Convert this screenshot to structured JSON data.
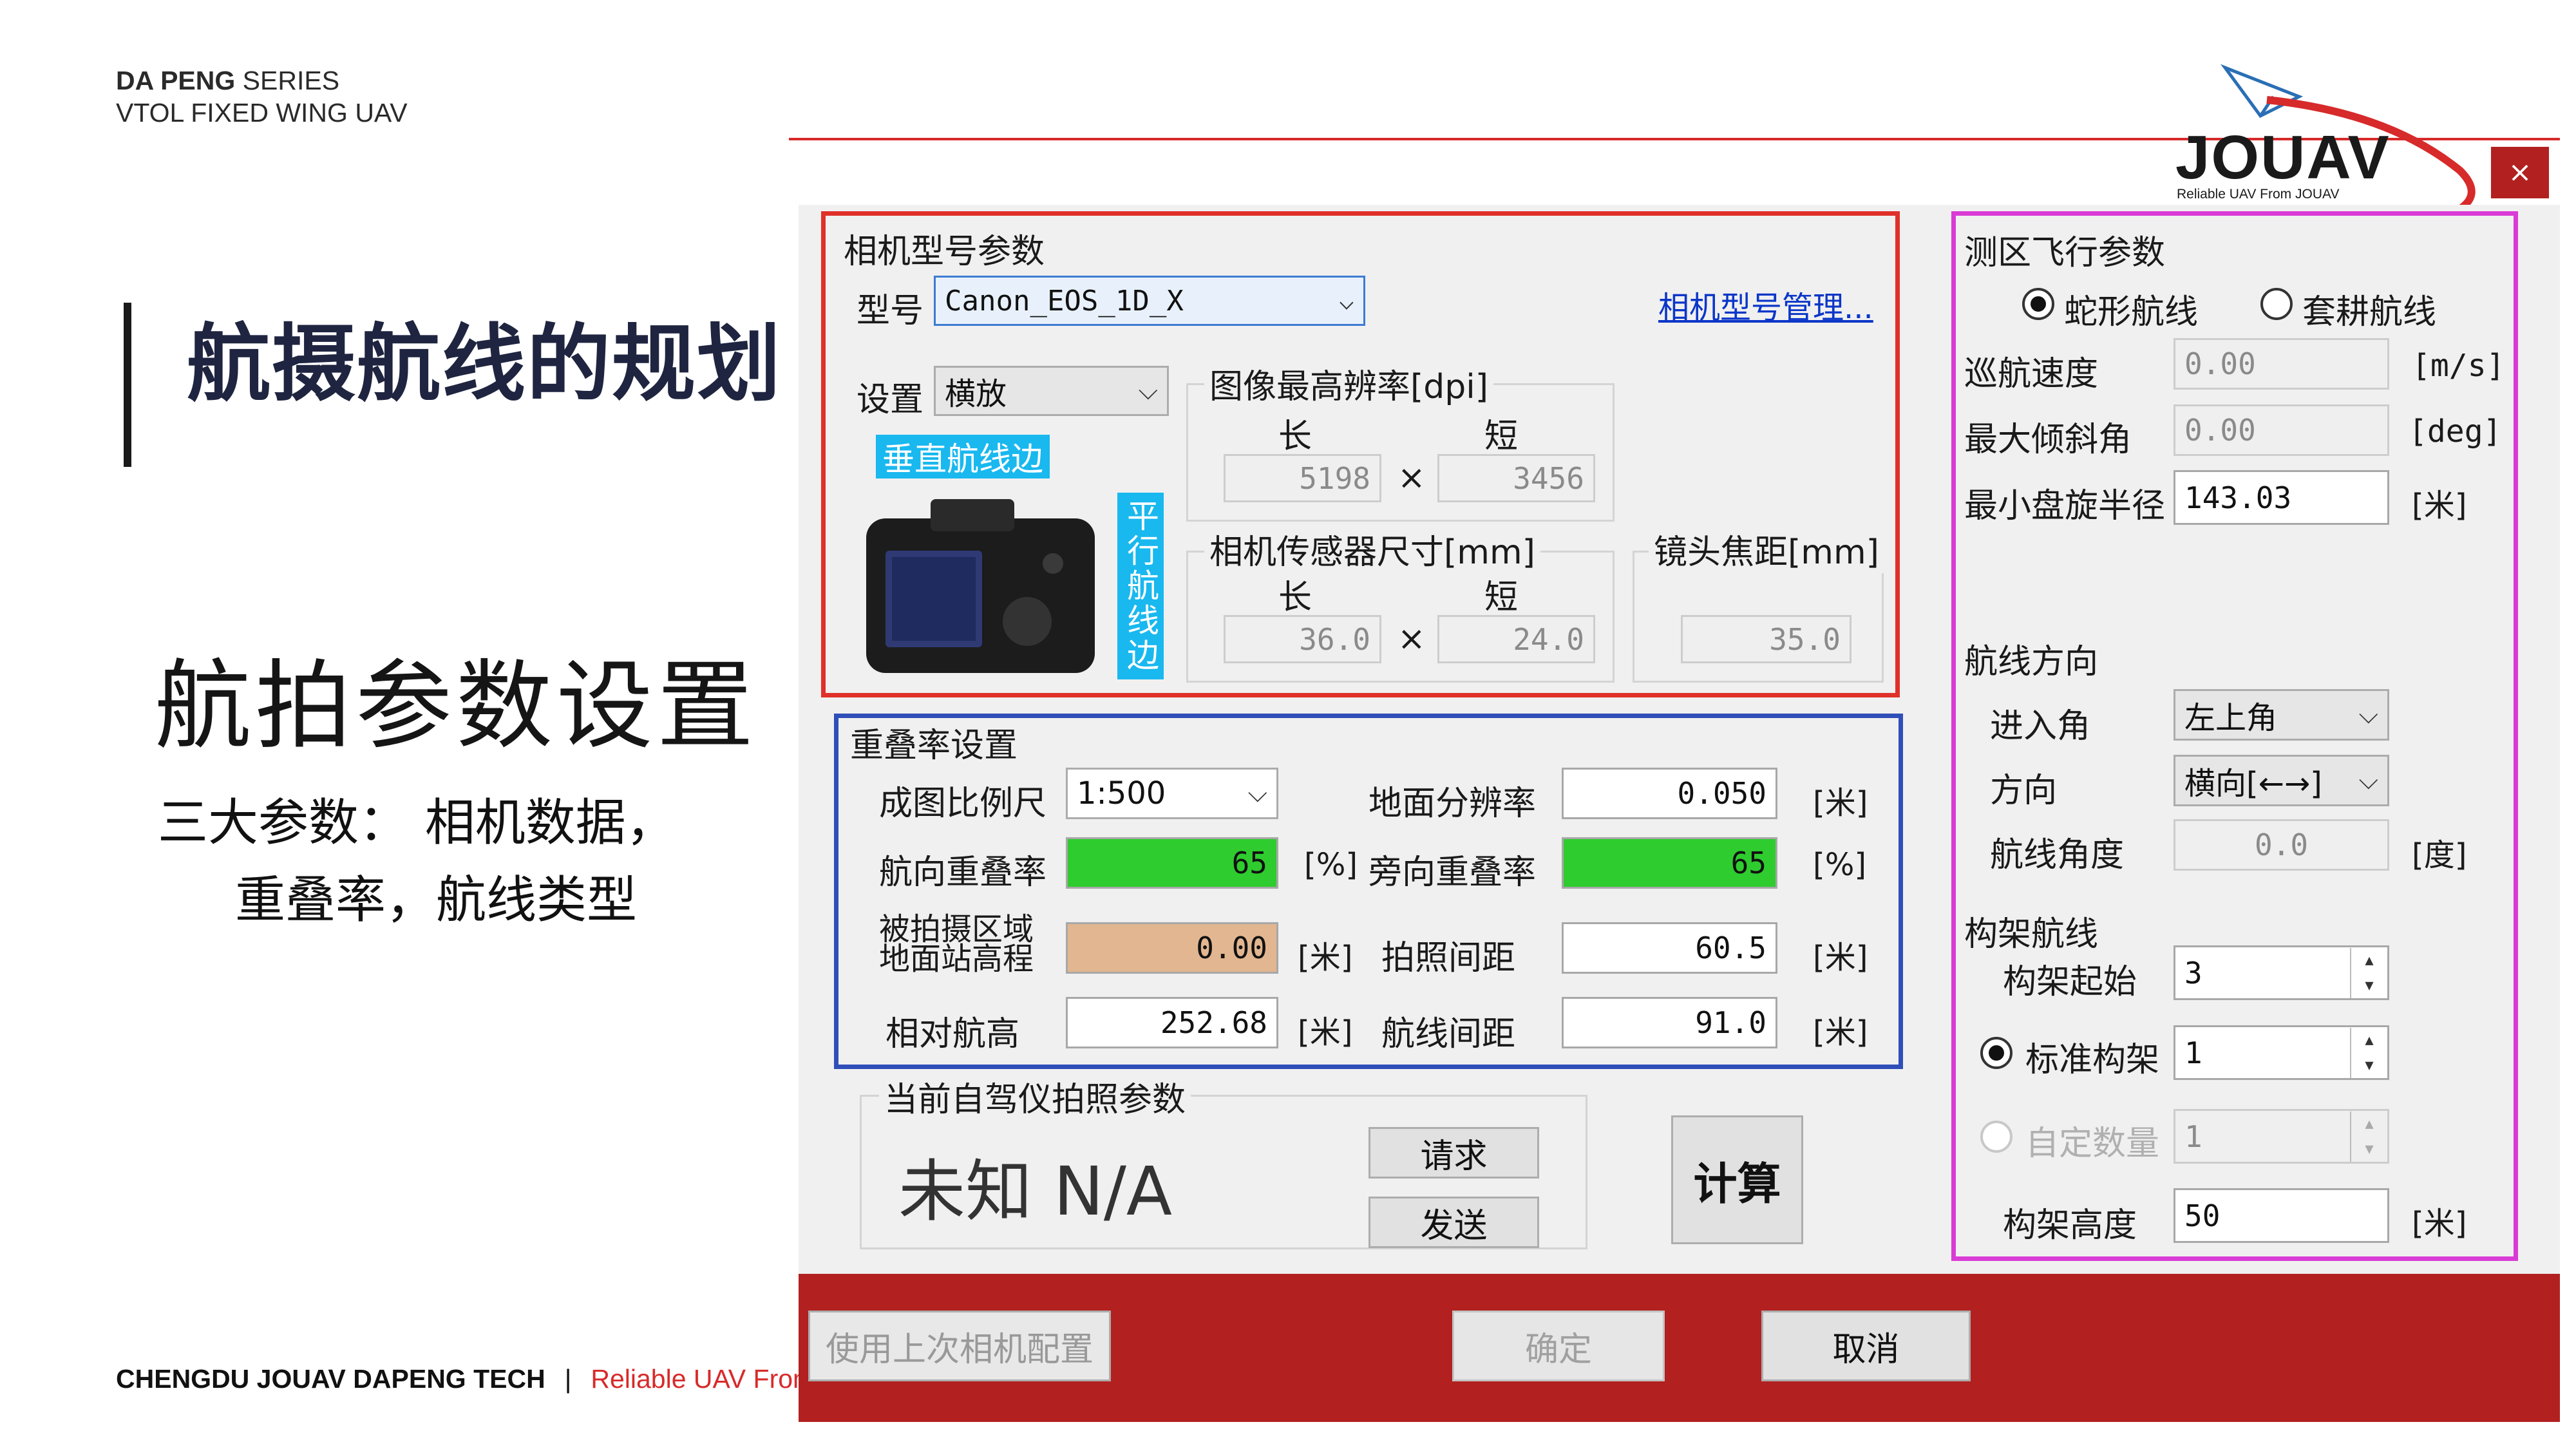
{
  "slide": {
    "brand_line1_bold": "DA PENG",
    "brand_line1_rest": " SERIES",
    "brand_line2": "VTOL FIXED WING UAV",
    "logo_text": "JOUAV",
    "logo_sub": "Reliable UAV From JOUAV",
    "main_title": "航摄航线的规划",
    "sub_title": "航拍参数设置",
    "desc_line1": "三大参数：  相机数据，",
    "desc_line2": "重叠率，航线类型",
    "footer_left": "CHENGDU JOUAV DAPENG TECH",
    "footer_sep": "|",
    "footer_right": "Reliable UAV From"
  },
  "colors": {
    "accent_red": "#d72a2a",
    "camera_box": "#e0302a",
    "overlap_box": "#2f4fb8",
    "flight_box": "#d93bd5",
    "overlap_green": "#2ecc2e",
    "elevation_tan": "#e2b690",
    "bottom_bar": "#b22020"
  },
  "dialog": {
    "close_icon": "×",
    "camera": {
      "group_title": "相机型号参数",
      "model_label": "型号",
      "model_value": "Canon_EOS_1D_X",
      "manage_link": "相机型号管理...",
      "setting_label": "设置",
      "setting_value": "横放",
      "vertical_edge_label": "垂直航线边",
      "parallel_edge_label": "平行航线边",
      "resolution_title": "图像最高辨率[dpi]",
      "long_label": "长",
      "short_label": "短",
      "res_long": "5198",
      "res_short": "3456",
      "times": "×",
      "sensor_title": "相机传感器尺寸[mm]",
      "sensor_long": "36.0",
      "sensor_short": "24.0",
      "focal_title": "镜头焦距[mm]",
      "focal_value": "35.0"
    },
    "overlap": {
      "group_title": "重叠率设置",
      "scale_label": "成图比例尺",
      "scale_value": "1:500",
      "gsd_label": "地面分辨率",
      "gsd_value": "0.050",
      "gsd_unit": "[米]",
      "forward_label": "航向重叠率",
      "forward_value": "65",
      "forward_unit": "[%]",
      "side_label": "旁向重叠率",
      "side_value": "65",
      "side_unit": "[%]",
      "elev_label_1": "被拍摄区域",
      "elev_label_2": "地面站高程",
      "elev_value": "0.00",
      "elev_unit": "[米]",
      "photo_interval_label": "拍照间距",
      "photo_interval_value": "60.5",
      "photo_interval_unit": "[米]",
      "rel_alt_label": "相对航高",
      "rel_alt_value": "252.68",
      "rel_alt_unit": "[米]",
      "line_spacing_label": "航线间距",
      "line_spacing_value": "91.0",
      "line_spacing_unit": "[米]"
    },
    "autopilot": {
      "group_title": "当前自驾仪拍照参数",
      "status": "未知 N/A",
      "request_button": "请求",
      "send_button": "发送",
      "calc_button": "计算"
    },
    "flight": {
      "group_title": "测区飞行参数",
      "snake_label": "蛇形航线",
      "snake_selected": true,
      "plow_label": "套耕航线",
      "plow_selected": false,
      "speed_label": "巡航速度",
      "speed_value": "0.00",
      "speed_unit": "[m/s]",
      "bank_label": "最大倾斜角",
      "bank_value": "0.00",
      "bank_unit": "[deg]",
      "radius_label": "最小盘旋半径",
      "radius_value": "143.03",
      "radius_unit": "[米]",
      "direction_group": "航线方向",
      "entry_label": "进入角",
      "entry_value": "左上角",
      "dir_label": "方向",
      "dir_value": "横向[←→]",
      "angle_label": "航线角度",
      "angle_value": "0.0",
      "angle_unit": "[度]",
      "frame_group": "构架航线",
      "frame_start_label": "构架起始",
      "frame_start_value": "3",
      "std_frame_label": "标准构架",
      "std_frame_value": "1",
      "custom_label": "自定数量",
      "custom_value": "1",
      "frame_height_label": "构架高度",
      "frame_height_value": "50",
      "frame_height_unit": "[米]"
    },
    "footer_buttons": {
      "use_last": "使用上次相机配置",
      "ok": "确定",
      "cancel": "取消"
    }
  }
}
